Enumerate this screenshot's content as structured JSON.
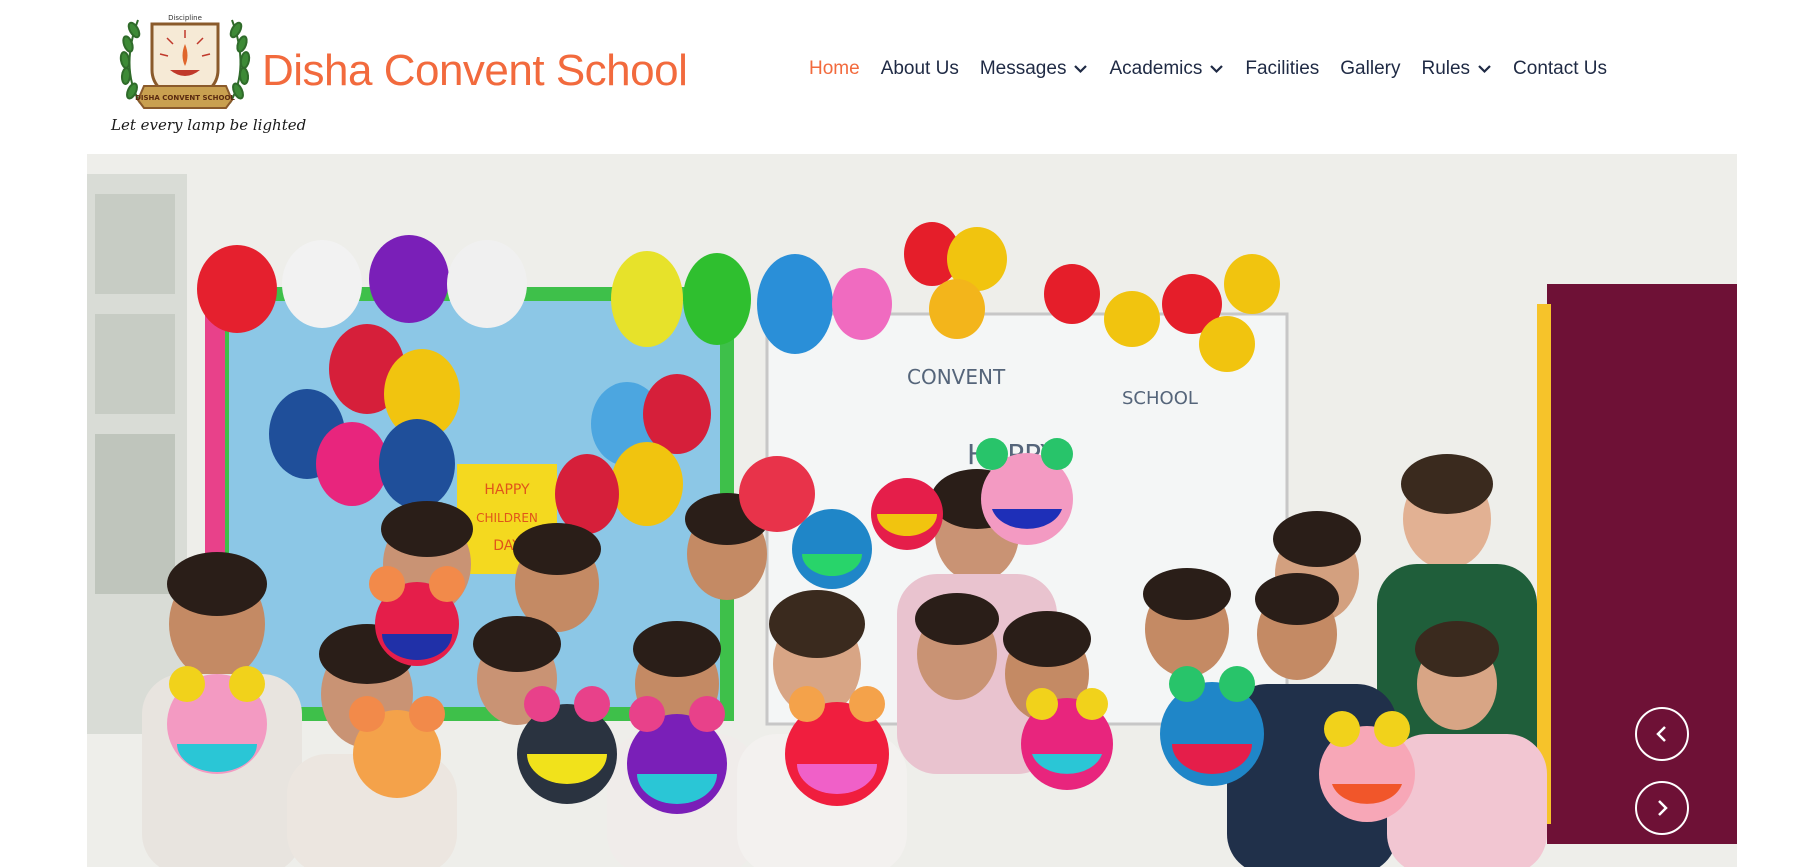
{
  "site": {
    "logo_icon": "school-crest-lamp-icon",
    "logo_ring_text": "DISHA CONVENT SCHOOL",
    "logo_top_text": "Discipline",
    "tagline": "Let every lamp be lighted",
    "title": "Disha Convent School",
    "brand_color": "#f26a3d",
    "text_color": "#1f2a44"
  },
  "nav": {
    "items": [
      {
        "label": "Home",
        "active": true
      },
      {
        "label": "About Us"
      },
      {
        "label": "Messages",
        "dropdown": true,
        "icon": "chevron-down-icon"
      },
      {
        "label": "Academics",
        "dropdown": true,
        "icon": "chevron-down-icon"
      },
      {
        "label": "Facilities"
      },
      {
        "label": "Gallery"
      },
      {
        "label": "Rules",
        "dropdown": true,
        "icon": "chevron-down-icon"
      },
      {
        "label": "Contact Us"
      }
    ]
  },
  "hero": {
    "image": "children-day-classroom-photo",
    "board_texts": [
      "HAPPY",
      "CHILDREN",
      "DAY",
      "CONVENT",
      "SCHOOL",
      "HAPPY"
    ],
    "prev_icon": "chevron-left-icon",
    "next_icon": "chevron-right-icon"
  }
}
